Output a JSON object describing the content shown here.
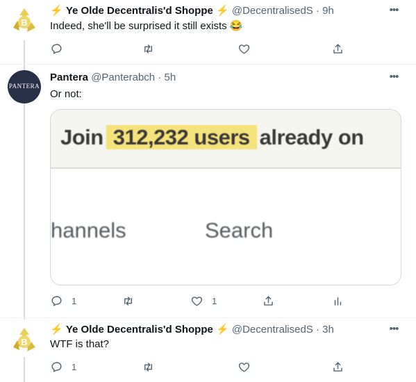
{
  "tweets": [
    {
      "name": "Ye Olde Decentralis'd Shoppe",
      "handle": "@DecentralisedS",
      "time": "9h",
      "text": "Indeed, she'll be surprised it still exists 😂",
      "replies": "",
      "retweets": "",
      "likes": ""
    },
    {
      "name": "Pantera",
      "handle": "@Panterabch",
      "time": "5h",
      "text": "Or not:",
      "avatar_text": "PANTERA",
      "replies": "1",
      "retweets": "",
      "likes": "1"
    },
    {
      "name": "Ye Olde Decentralis'd Shoppe",
      "handle": "@DecentralisedS",
      "time": "3h",
      "text": "WTF is that?",
      "replies": "1",
      "retweets": "",
      "likes": ""
    }
  ],
  "card": {
    "join": "Join",
    "highlight": "312,232 users",
    "rest": "already on",
    "word1": "hannels",
    "word2": "Search"
  },
  "separator": "·",
  "bolt": "⚡",
  "more": "•••",
  "colors": {
    "meta": "#536471",
    "highlight": "#f6e27a",
    "avatar_dark": "#283048"
  }
}
